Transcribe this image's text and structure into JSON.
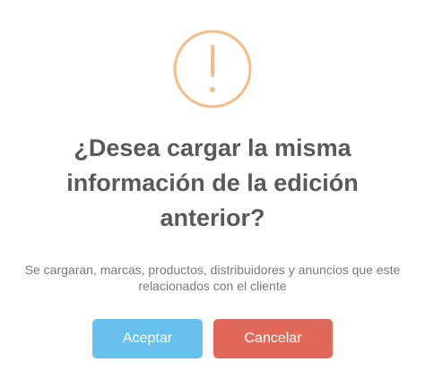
{
  "dialog": {
    "icon": "warning-exclamation-icon",
    "icon_color": "#f8bb86",
    "title": "¿Desea cargar la misma información de la edición anterior?",
    "message": "Se cargaran, marcas, productos, distribuidores y anuncios que este relacionados con el cliente",
    "buttons": {
      "accept_label": "Aceptar",
      "accept_color": "#68c0ec",
      "cancel_label": "Cancelar",
      "cancel_color": "#e2695a"
    }
  }
}
